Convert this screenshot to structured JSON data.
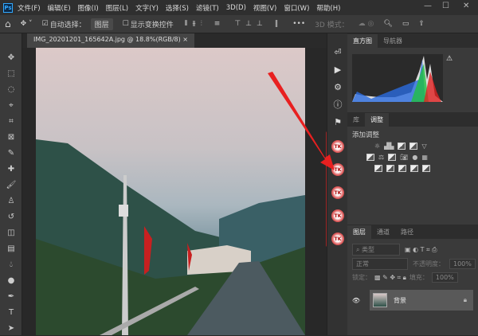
{
  "menubar": {
    "logo": "Ps",
    "items": [
      "文件(F)",
      "编辑(E)",
      "图像(I)",
      "图层(L)",
      "文字(Y)",
      "选择(S)",
      "滤镜(T)",
      "3D(D)",
      "视图(V)",
      "窗口(W)",
      "帮助(H)"
    ],
    "minimize": "—",
    "maximize": "☐",
    "close": "✕"
  },
  "options": {
    "auto_select_label": "自动选择：",
    "auto_select_value": "图层",
    "show_transform": "显示变换控件",
    "more": "•••",
    "mode_3d": "3D 模式："
  },
  "document": {
    "tab_title": "IMG_20201201_165642A.jpg @ 18.8%(RGB/8)",
    "close": "×"
  },
  "panels": {
    "histogram_tabs": [
      "直方图",
      "导航器"
    ],
    "adjust_tabs": [
      "库",
      "调整"
    ],
    "adjust_title": "添加调整",
    "layers_tabs": [
      "图层",
      "通道",
      "路径"
    ],
    "filter_kind": "类型",
    "blend_mode": "正常",
    "opacity_label": "不透明度：",
    "opacity_value": "100%",
    "lock_label": "锁定：",
    "fill_label": "填充：",
    "fill_value": "100%",
    "layer_name": "背景"
  },
  "plugin_icon_label": "TK",
  "plugin_icon_count": 6,
  "colors": {
    "highlight": "#c82828",
    "arrow": "#e82020"
  }
}
